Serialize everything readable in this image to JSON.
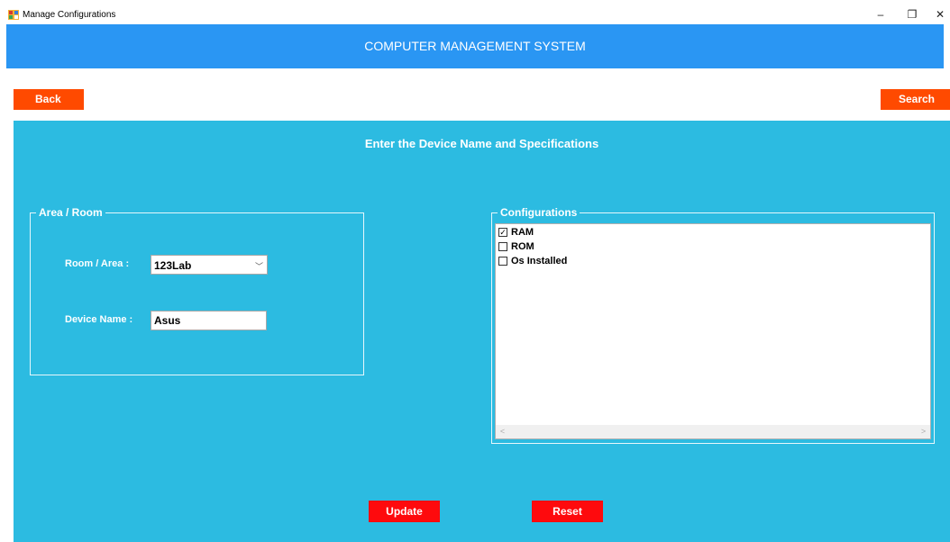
{
  "window": {
    "title": "Manage Configurations",
    "minimize_glyph": "–",
    "restore_glyph": "❐",
    "close_glyph": "✕"
  },
  "header": {
    "title": "COMPUTER MANAGEMENT SYSTEM"
  },
  "toolbar": {
    "back_label": "Back",
    "search_label": "Search"
  },
  "panel": {
    "heading": "Enter the Device Name and Specifications"
  },
  "area_group": {
    "legend": "Area / Room",
    "room_label": "Room / Area :",
    "room_value": "123Lab",
    "device_label": "Device Name :",
    "device_value": "Asus"
  },
  "config_group": {
    "legend": "Configurations",
    "items": [
      {
        "label": "RAM",
        "checked": true
      },
      {
        "label": "ROM",
        "checked": false
      },
      {
        "label": "Os Installed",
        "checked": false
      }
    ]
  },
  "actions": {
    "update_label": "Update",
    "reset_label": "Reset"
  },
  "colors": {
    "header_bg": "#2a96f3",
    "panel_bg": "#2cbbe1",
    "nav_button_bg": "#ff4a00",
    "action_button_bg": "#fe0a0d"
  }
}
